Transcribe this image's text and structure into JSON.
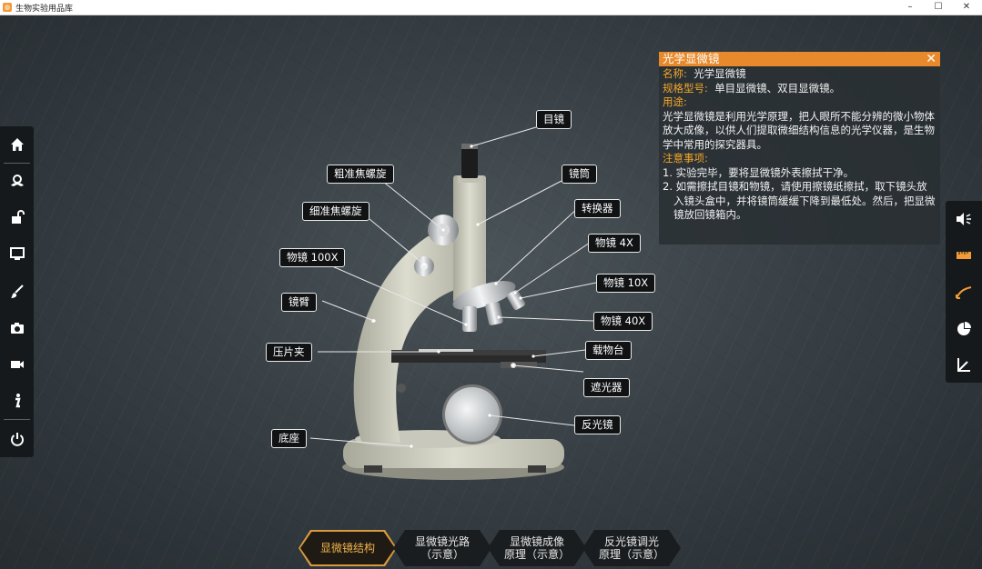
{
  "window": {
    "title": "生物实验用品库",
    "minimize": "–",
    "maximize": "☐",
    "close": "✕"
  },
  "info": {
    "title": "光学显微镜",
    "close": "✕",
    "name_label": "名称:",
    "name_value": "光学显微镜",
    "model_label": "规格型号:",
    "model_value": "单目显微镜、双目显微镜。",
    "usage_label": "用途:",
    "usage_text": "光学显微镜是利用光学原理，把人眼所不能分辨的微小物体放大成像，以供人们提取微细结构信息的光学仪器，是生物学中常用的探究器具。",
    "notes_label": "注意事项:",
    "notes": [
      "1. 实验完毕，要将显微镜外表擦拭干净。",
      "2. 如需擦拭目镜和物镜，请使用擦镜纸擦拭，取下镜头放入镜头盒中，并将镜筒缓缓下降到最低处。然后，把显微镜放回镜箱内。"
    ]
  },
  "labels": {
    "eyepiece": "目镜",
    "coarse": "粗准焦螺旋",
    "tube": "镜筒",
    "fine": "细准焦螺旋",
    "nosepiece": "转换器",
    "obj100": "物镜 100X",
    "obj4": "物镜 4X",
    "obj10": "物镜 10X",
    "arm": "镜臂",
    "obj40": "物镜 40X",
    "clip": "压片夹",
    "stage": "载物台",
    "diaphragm": "遮光器",
    "mirror": "反光镜",
    "base": "底座"
  },
  "tabs": [
    {
      "label": "显微镜结构",
      "active": true
    },
    {
      "label": "显微镜光路\n（示意）",
      "active": false
    },
    {
      "label": "显微镜成像\n原理（示意）",
      "active": false
    },
    {
      "label": "反光镜调光\n原理（示意）",
      "active": false
    }
  ],
  "left_toolbar": [
    "home-icon",
    "model-icon",
    "unlock-icon",
    "monitor-icon",
    "brush-icon",
    "camera-icon",
    "video-icon",
    "info-icon",
    "power-icon"
  ],
  "right_toolbar": [
    "speaker-icon",
    "ruler-icon",
    "curve-icon",
    "pie-chart-icon",
    "axis-icon"
  ],
  "colors": {
    "accent": "#e88a2b",
    "highlight_text": "#f4a62a",
    "tab_active_border": "#d89a3c"
  }
}
